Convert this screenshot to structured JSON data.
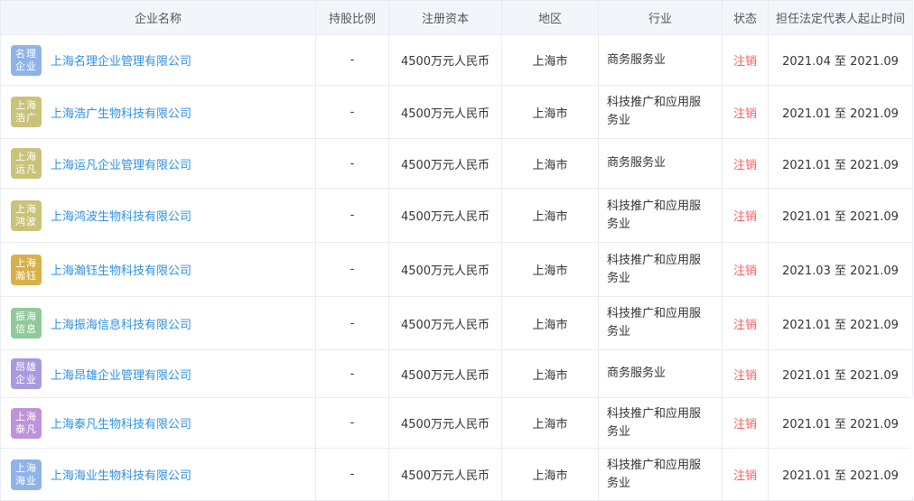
{
  "headers": [
    "企业名称",
    "持股比例",
    "注册资本",
    "地区",
    "行业",
    "状态",
    "担任法定代表人起止时间"
  ],
  "rows": [
    {
      "logo": "名理企业",
      "logo_color": "#8fb3e8",
      "name": "上海名理企业管理有限公司",
      "share": "-",
      "capital": "4500万元人民币",
      "region": "上海市",
      "industry": "商务服务业",
      "status": "注销",
      "period": "2021.04 至 2021.09"
    },
    {
      "logo": "上海浩广",
      "logo_color": "#c9c37a",
      "name": "上海浩广生物科技有限公司",
      "share": "-",
      "capital": "4500万元人民币",
      "region": "上海市",
      "industry": "科技推广和应用服务业",
      "status": "注销",
      "period": "2021.01 至 2021.09"
    },
    {
      "logo": "上海运凡",
      "logo_color": "#c9c37a",
      "name": "上海运凡企业管理有限公司",
      "share": "-",
      "capital": "4500万元人民币",
      "region": "上海市",
      "industry": "商务服务业",
      "status": "注销",
      "period": "2021.01 至 2021.09"
    },
    {
      "logo": "上海鸿波",
      "logo_color": "#c9c37a",
      "name": "上海鸿波生物科技有限公司",
      "share": "-",
      "capital": "4500万元人民币",
      "region": "上海市",
      "industry": "科技推广和应用服务业",
      "status": "注销",
      "period": "2021.01 至 2021.09"
    },
    {
      "logo": "上海瀚钰",
      "logo_color": "#d8b048",
      "name": "上海瀚钰生物科技有限公司",
      "share": "-",
      "capital": "4500万元人民币",
      "region": "上海市",
      "industry": "科技推广和应用服务业",
      "status": "注销",
      "period": "2021.03 至 2021.09"
    },
    {
      "logo": "振海信息",
      "logo_color": "#90c99a",
      "name": "上海振海信息科技有限公司",
      "share": "-",
      "capital": "4500万元人民币",
      "region": "上海市",
      "industry": "科技推广和应用服务业",
      "status": "注销",
      "period": "2021.01 至 2021.09"
    },
    {
      "logo": "昂雄企业",
      "logo_color": "#a99ae0",
      "name": "上海昂雄企业管理有限公司",
      "share": "-",
      "capital": "4500万元人民币",
      "region": "上海市",
      "industry": "商务服务业",
      "status": "注销",
      "period": "2021.01 至 2021.09"
    },
    {
      "logo": "上海泰凡",
      "logo_color": "#bf93d9",
      "name": "上海泰凡生物科技有限公司",
      "share": "-",
      "capital": "4500万元人民币",
      "region": "上海市",
      "industry": "科技推广和应用服务业",
      "status": "注销",
      "period": "2021.01 至 2021.09"
    },
    {
      "logo": "上海海业",
      "logo_color": "#8fb3e8",
      "name": "上海海业生物科技有限公司",
      "share": "-",
      "capital": "4500万元人民币",
      "region": "上海市",
      "industry": "科技推广和应用服务业",
      "status": "注销",
      "period": "2021.01 至 2021.09"
    }
  ]
}
